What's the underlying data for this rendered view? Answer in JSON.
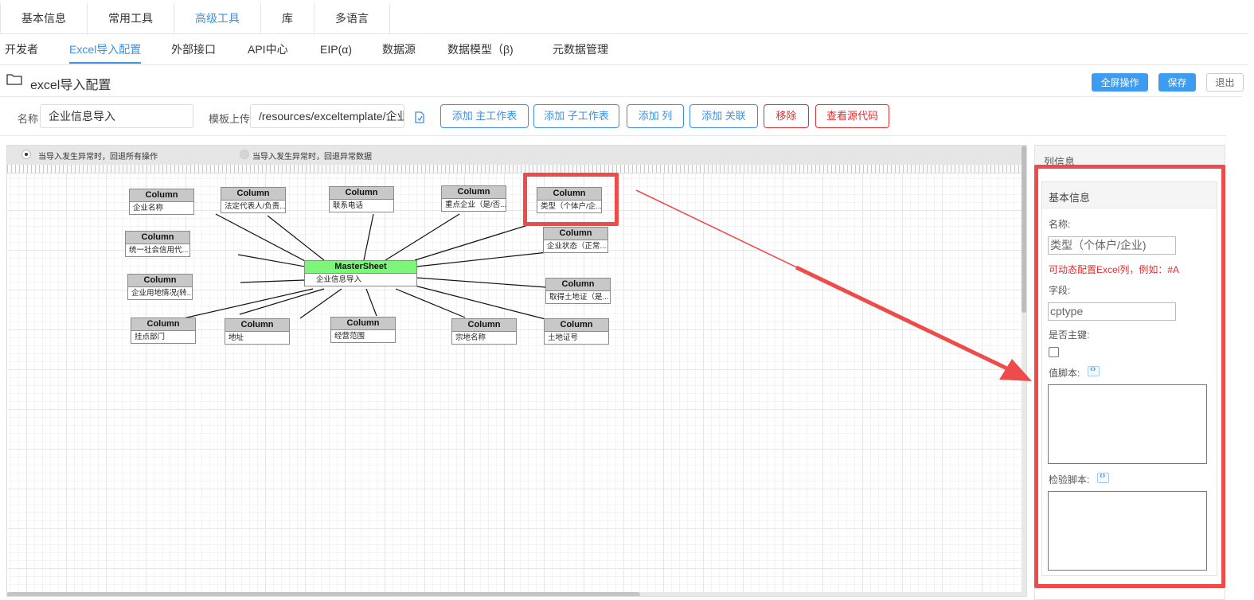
{
  "top_tabs": [
    "基本信息",
    "常用工具",
    "高级工具",
    "库",
    "多语言"
  ],
  "top_tab_active": "高级工具",
  "sub_tabs": [
    "开发者",
    "Excel导入配置",
    "外部接口",
    "API中心",
    "EIP(α)",
    "数据源",
    "数据模型（β)",
    "元数据管理"
  ],
  "sub_tab_active": "Excel导入配置",
  "page": {
    "title": "excel导入配置",
    "fullscreen_btn": "全屏操作",
    "save_btn": "保存",
    "exit_btn": "退出"
  },
  "form": {
    "name_label": "名称",
    "name_value": "企业信息导入",
    "template_label": "模板上传",
    "template_value": "/resources/exceltemplate/企业",
    "buttons": {
      "add_main": "添加 主工作表",
      "add_sub": "添加 子工作表",
      "add_col": "添加 列",
      "add_link": "添加 关联",
      "remove": "移除",
      "view_source": "查看源代码"
    }
  },
  "canvas": {
    "radio_1": "当导入发生异常时，回退所有操作",
    "radio_2": "当导入发生异常时，回退异常数据",
    "master": {
      "header": "MasterSheet",
      "label": "企业信息导入"
    },
    "column_header": "Column",
    "columns": [
      "企业名称",
      "法定代表人/负责...",
      "联系电话",
      "重点企业（是/否...",
      "类型（个体户/企...",
      "统一社会信用代...",
      "企业状态（正常...",
      "企业用地情况(转...",
      "取得土地证（是...",
      "挂点部门",
      "地址",
      "经营范围",
      "宗地名称",
      "土地证号"
    ]
  },
  "panel": {
    "title": "列信息",
    "section": "基本信息",
    "name_label": "名称:",
    "name_value": "类型（个体户/企业)",
    "hint": "可动态配置Excel列，例如：#A",
    "field_label": "字段:",
    "field_value": "cptype",
    "pk_label": "是否主键:",
    "value_script_label": "值脚本:",
    "check_script_label": "检验脚本:"
  }
}
